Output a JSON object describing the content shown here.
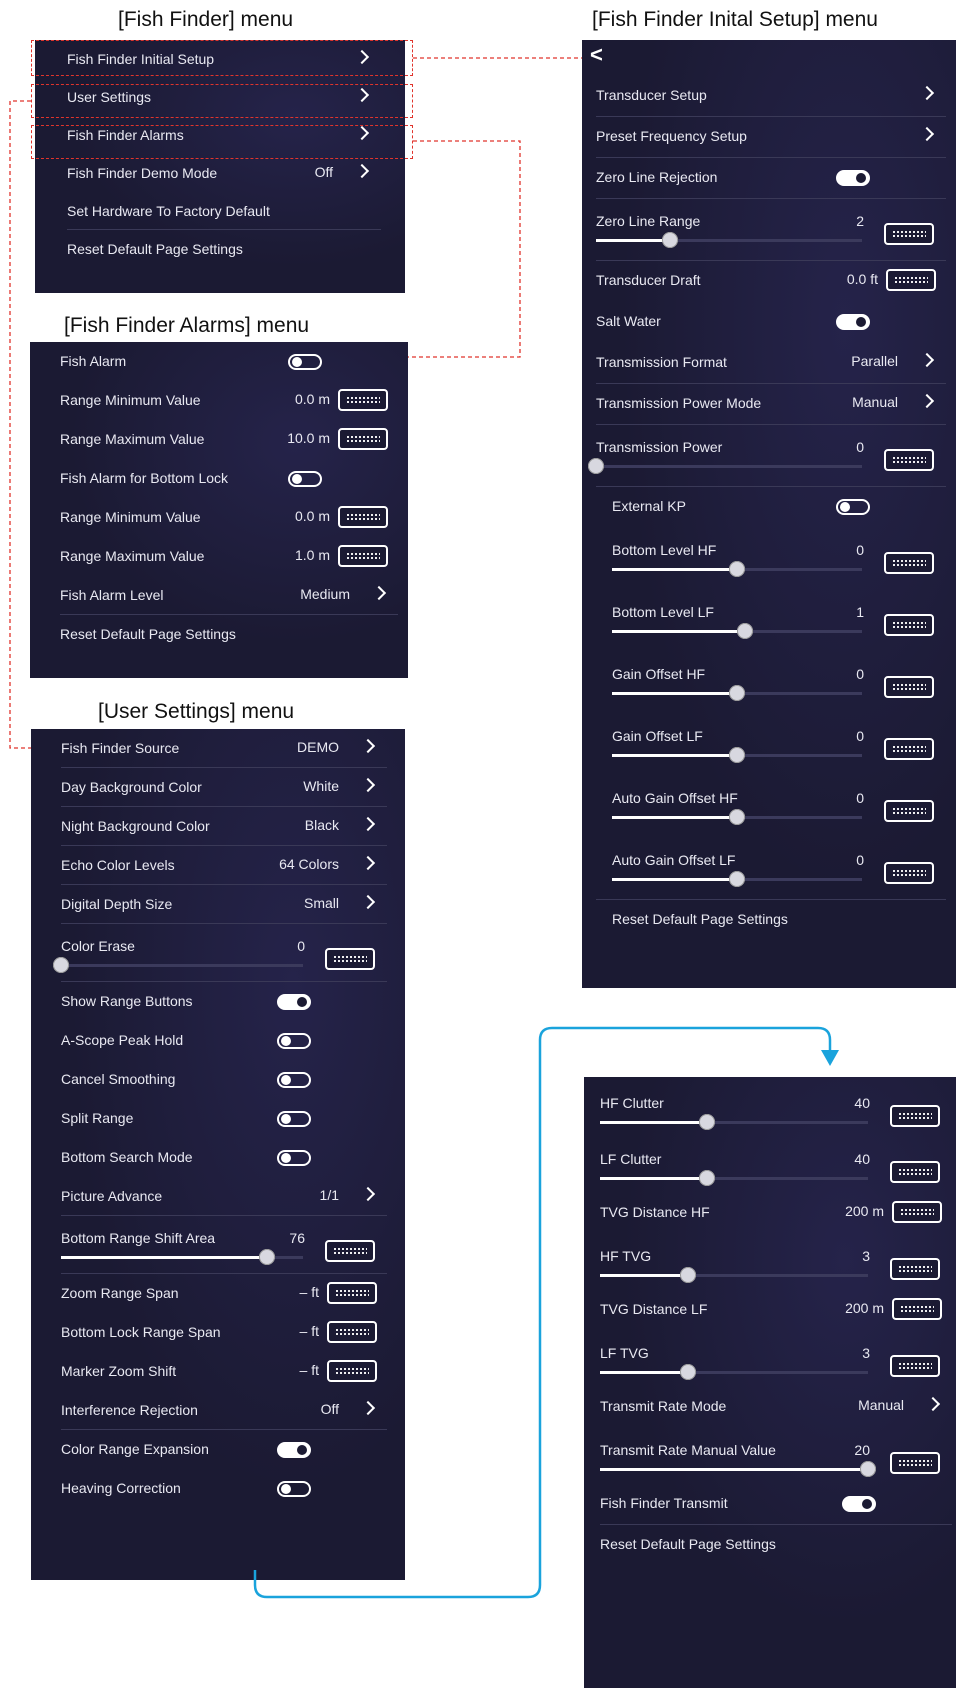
{
  "captions": {
    "fish_finder": "[Fish Finder] menu",
    "initial_setup": "[Fish Finder Inital Setup] menu",
    "alarms": "[Fish Finder Alarms] menu",
    "user_settings": "[User Settings] menu"
  },
  "fish_finder_menu": {
    "items": [
      {
        "label": "Fish Finder Initial Setup",
        "value": "",
        "chevron": true
      },
      {
        "label": "User Settings",
        "value": "",
        "chevron": true
      },
      {
        "label": "Fish Finder Alarms",
        "value": "",
        "chevron": true
      },
      {
        "label": "Fish Finder Demo Mode",
        "value": "Off",
        "chevron": true
      },
      {
        "label": "Set Hardware To Factory Default",
        "value": "",
        "chevron": false
      },
      {
        "label": "Reset Default Page Settings",
        "value": "",
        "chevron": false
      }
    ]
  },
  "alarms_menu": {
    "items": [
      {
        "label": "Fish Alarm",
        "type": "toggle",
        "state": "off"
      },
      {
        "label": "Range Minimum Value",
        "type": "kbd",
        "value": "0.0 m"
      },
      {
        "label": "Range Maximum Value",
        "type": "kbd",
        "value": "10.0 m"
      },
      {
        "label": "Fish Alarm for Bottom Lock",
        "type": "toggle",
        "state": "off"
      },
      {
        "label": "Range Minimum Value",
        "type": "kbd",
        "value": "0.0 m"
      },
      {
        "label": "Range Maximum Value",
        "type": "kbd",
        "value": "1.0 m"
      },
      {
        "label": "Fish Alarm Level",
        "type": "chevron",
        "value": "Medium"
      },
      {
        "label": "Reset Default Page Settings",
        "type": "plain"
      }
    ]
  },
  "user_settings_menu": {
    "items": [
      {
        "label": "Fish Finder Source",
        "type": "chevron",
        "value": "DEMO"
      },
      {
        "label": "Day Background Color",
        "type": "chevron",
        "value": "White"
      },
      {
        "label": "Night Background Color",
        "type": "chevron",
        "value": "Black"
      },
      {
        "label": "Echo Color Levels",
        "type": "chevron",
        "value": "64 Colors"
      },
      {
        "label": "Digital Depth Size",
        "type": "chevron",
        "value": "Small"
      },
      {
        "label": "Color Erase",
        "type": "slider",
        "value": "0",
        "level": 0
      },
      {
        "label": "Show Range Buttons",
        "type": "toggle",
        "state": "on"
      },
      {
        "label": "A-Scope Peak Hold",
        "type": "toggle",
        "state": "off"
      },
      {
        "label": "Cancel Smoothing",
        "type": "toggle",
        "state": "off"
      },
      {
        "label": "Split Range",
        "type": "toggle",
        "state": "off"
      },
      {
        "label": "Bottom Search Mode",
        "type": "toggle",
        "state": "off"
      },
      {
        "label": "Picture Advance",
        "type": "chevron",
        "value": "1/1"
      },
      {
        "label": "Bottom Range Shift Area",
        "type": "slider",
        "value": "76",
        "level": 0.85
      },
      {
        "label": "Zoom Range Span",
        "type": "kbd",
        "value": "– ft"
      },
      {
        "label": "Bottom Lock Range Span",
        "type": "kbd",
        "value": "– ft"
      },
      {
        "label": "Marker Zoom Shift",
        "type": "kbd",
        "value": "– ft"
      },
      {
        "label": "Interference Rejection",
        "type": "chevron",
        "value": "Off"
      },
      {
        "label": "Color Range Expansion",
        "type": "toggle",
        "state": "on"
      },
      {
        "label": "Heaving Correction",
        "type": "toggle",
        "state": "off"
      }
    ]
  },
  "initial_setup_menu": {
    "back": "<",
    "items": [
      {
        "label": "Transducer Setup",
        "type": "chevron",
        "value": ""
      },
      {
        "label": "Preset Frequency Setup",
        "type": "chevron",
        "value": ""
      },
      {
        "label": "Zero Line Rejection",
        "type": "toggle",
        "state": "on"
      },
      {
        "label": "Zero Line Range",
        "type": "slider",
        "value": "2",
        "level": 0.28
      },
      {
        "label": "Transducer Draft",
        "type": "kbd",
        "value": "0.0 ft"
      },
      {
        "label": "Salt Water",
        "type": "toggle",
        "state": "on"
      },
      {
        "label": "Transmission Format",
        "type": "chevron",
        "value": "Parallel"
      },
      {
        "label": "Transmission Power Mode",
        "type": "chevron",
        "value": "Manual"
      },
      {
        "label": "Transmission Power",
        "type": "slider",
        "value": "0",
        "level": 0
      },
      {
        "label": "External KP",
        "type": "toggle",
        "state": "off",
        "indent": true
      },
      {
        "label": "Bottom Level HF",
        "type": "slider",
        "value": "0",
        "level": 0.5,
        "indent": true
      },
      {
        "label": "Bottom Level LF",
        "type": "slider",
        "value": "1",
        "level": 0.53,
        "indent": true
      },
      {
        "label": "Gain Offset HF",
        "type": "slider",
        "value": "0",
        "level": 0.5,
        "indent": true
      },
      {
        "label": "Gain Offset LF",
        "type": "slider",
        "value": "0",
        "level": 0.5,
        "indent": true
      },
      {
        "label": "Auto Gain Offset HF",
        "type": "slider",
        "value": "0",
        "level": 0.5,
        "indent": true
      },
      {
        "label": "Auto Gain Offset LF",
        "type": "slider",
        "value": "0",
        "level": 0.5,
        "indent": true
      },
      {
        "label": "Reset Default Page Settings",
        "type": "plain",
        "indent": true
      }
    ]
  },
  "initial_setup_continued": {
    "items": [
      {
        "label": "HF Clutter",
        "type": "slider",
        "value": "40",
        "level": 0.4
      },
      {
        "label": "LF Clutter",
        "type": "slider",
        "value": "40",
        "level": 0.4
      },
      {
        "label": "TVG Distance HF",
        "type": "kbd",
        "value": "200 m"
      },
      {
        "label": "HF TVG",
        "type": "slider",
        "value": "3",
        "level": 0.33
      },
      {
        "label": "TVG Distance LF",
        "type": "kbd",
        "value": "200 m"
      },
      {
        "label": "LF TVG",
        "type": "slider",
        "value": "3",
        "level": 0.33
      },
      {
        "label": "Transmit Rate Mode",
        "type": "chevron",
        "value": "Manual"
      },
      {
        "label": "Transmit Rate Manual Value",
        "type": "slider",
        "value": "20",
        "level": 1
      },
      {
        "label": "Fish Finder Transmit",
        "type": "toggle",
        "state": "on"
      },
      {
        "label": "Reset Default Page Settings",
        "type": "plain"
      }
    ]
  },
  "colors": {
    "panel": "#1b1a33",
    "highlight": "#e0342c",
    "connector": "#1aa3dc"
  }
}
